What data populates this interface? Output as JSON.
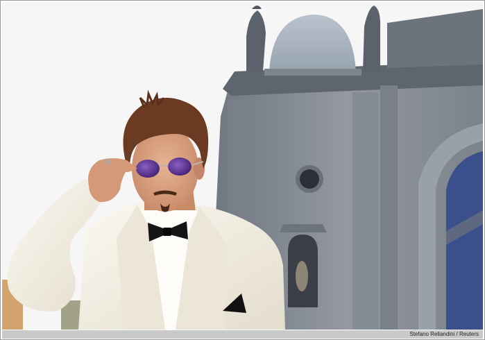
{
  "photo": {
    "subject": "man-in-white-tuxedo",
    "credit": "Stefano Rellandini / Reuters"
  },
  "colors": {
    "sky": "#f7f7f7",
    "building_stone": "#8d9299",
    "dome": "#a9b4c0",
    "tuxedo": "#f3efe4",
    "hair": "#6b3a22",
    "skin": "#d8a07f",
    "lens": "#5a2e8c",
    "bowtie": "#151515",
    "credit_bar": "#c9c9c9"
  }
}
